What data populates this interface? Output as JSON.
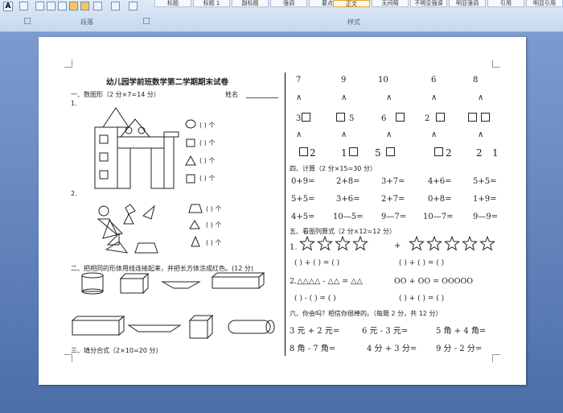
{
  "ribbon": {
    "styles": [
      "标题",
      "标题 1",
      "副标题",
      "强调",
      "要点",
      "正文",
      "无间隔",
      "不明显强调",
      "明显强调",
      "引用",
      "明显引用"
    ],
    "active_style": "正文",
    "group_paragraph": "段落",
    "group_styles": "样式",
    "tool_left_a": "A"
  },
  "doc": {
    "title": "幼儿园学前班数学第二学期期末试卷",
    "s1": "一、数图形（2 分×7=14 分）",
    "name_label": "姓名",
    "q1": "1.",
    "q2": "2.",
    "ge": "个",
    "paren": "(    )",
    "s2": "二、把相同的形体用线连接起来，并把长方体涂成红色。(12 分)",
    "s3": "三、填分合式（2×10=20 分）",
    "top_nums": [
      "7",
      "9",
      "10",
      "6",
      "8"
    ],
    "wedge": "∧",
    "row2": [
      "3",
      "5",
      "6",
      "2"
    ],
    "row3": [
      "2",
      "1",
      "5",
      "2",
      "2",
      "1"
    ],
    "s4": "四、计算（2 分×15=30 分）",
    "calc": [
      [
        "0+9=",
        "2+8=",
        "3+7=",
        "4+6=",
        "5+5="
      ],
      [
        "5+5=",
        "3+6=",
        "2+7=",
        "0+8=",
        "1+9="
      ],
      [
        "4+5=",
        "10—5=",
        "9—7=",
        "10—7=",
        "9—9="
      ]
    ],
    "s5": "五、看图列算式（2 分×12=12 分）",
    "s5_q1": "1.",
    "plus": "+",
    "blank_eq1": "(     ) + (     ) = (     )",
    "blank_eq2": "(     ) + (     ) = (     )",
    "s5_q2": "2.△△△△ - △△ = △△",
    "circles": "OO + OO = OOOOO",
    "blank_eq3": "(     ) - (     ) = (     )",
    "blank_eq4": "(     ) + (     ) = (     )",
    "s6": "六、你会吗？相信你很棒的。（每题 2 分，共 12 分）",
    "units": [
      [
        "3 元 + 2 元=",
        "6 元 - 3 元=",
        "5 角 + 4 角="
      ],
      [
        "8 角 - 7 角=",
        "4 分 + 3 分=",
        "9 分 - 2 分="
      ]
    ]
  }
}
